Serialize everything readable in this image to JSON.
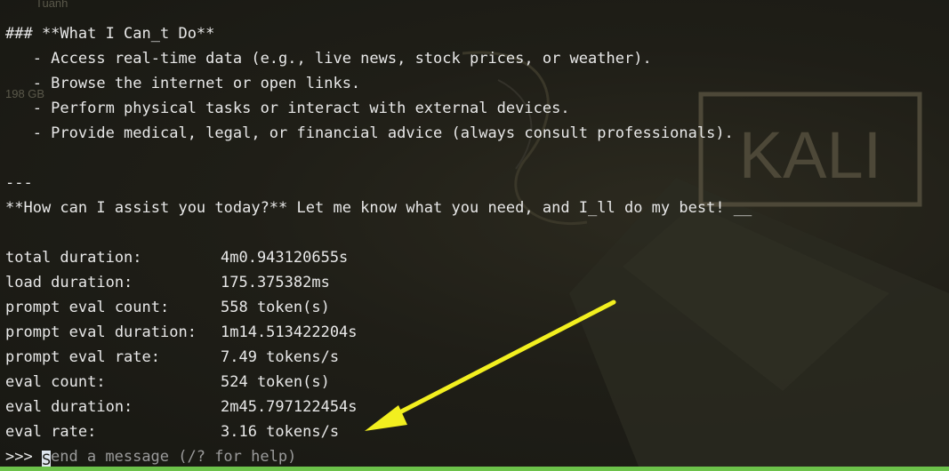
{
  "background": {
    "logo_text": "KALI",
    "faded_text_1": "Tuanh",
    "faded_text_2": "198 GB",
    "accent_green": "#6cc24a",
    "arrow_color": "#f2ef1f"
  },
  "output": {
    "heading": "### **What I Can_t Do**",
    "bullets": [
      "   - Access real-time data (e.g., live news, stock prices, or weather).",
      "   - Browse the internet or open links.",
      "   - Perform physical tasks or interact with external devices.",
      "   - Provide medical, legal, or financial advice (always consult professionals)."
    ],
    "separator": "---",
    "closing": "**How can I assist you today?** Let me know what you need, and I_ll do my best! __"
  },
  "stats": [
    {
      "label": "total duration:",
      "value": "4m0.943120655s"
    },
    {
      "label": "load duration:",
      "value": "175.375382ms"
    },
    {
      "label": "prompt eval count:",
      "value": "558 token(s)"
    },
    {
      "label": "prompt eval duration:",
      "value": "1m14.513422204s"
    },
    {
      "label": "prompt eval rate:",
      "value": "7.49 tokens/s"
    },
    {
      "label": "eval count:",
      "value": "524 token(s)"
    },
    {
      "label": "eval duration:",
      "value": "2m45.797122454s"
    },
    {
      "label": "eval rate:",
      "value": "3.16 tokens/s"
    }
  ],
  "prompt": {
    "symbol": ">>>",
    "cursor_char": "S",
    "placeholder_rest": "end a message (/? for help)"
  }
}
